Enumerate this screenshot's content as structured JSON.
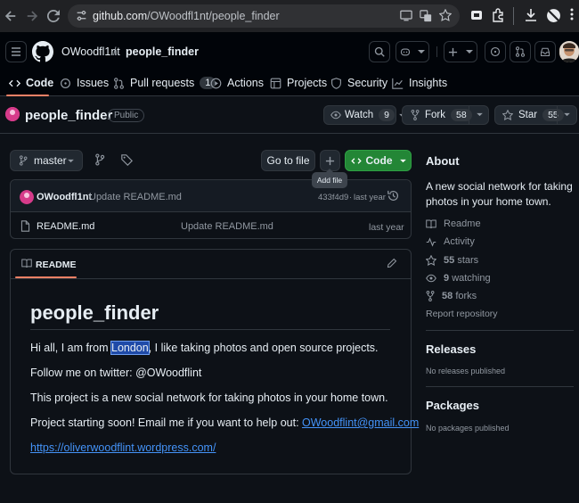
{
  "browser": {
    "url_host": "github.com",
    "url_path": "/OWoodfl1nt/people_finder"
  },
  "header": {
    "owner": "OWoodfl1nt",
    "separator": "/",
    "repo": "people_finder",
    "tabs": [
      {
        "label": "Code",
        "icon": "code-icon"
      },
      {
        "label": "Issues",
        "icon": "issue-icon"
      },
      {
        "label": "Pull requests",
        "icon": "pull-request-icon",
        "count": "1"
      },
      {
        "label": "Actions",
        "icon": "play-icon"
      },
      {
        "label": "Projects",
        "icon": "table-icon"
      },
      {
        "label": "Security",
        "icon": "shield-icon"
      },
      {
        "label": "Insights",
        "icon": "graph-icon"
      }
    ]
  },
  "repo": {
    "name": "people_finder",
    "visibility": "Public",
    "watch_label": "Watch",
    "watch_count": "9",
    "fork_label": "Fork",
    "fork_count": "58",
    "star_label": "Star",
    "star_count": "55"
  },
  "toolbar": {
    "branch": "master",
    "goto_file": "Go to file",
    "add_file_tooltip": "Add file",
    "code_button": "Code"
  },
  "commit": {
    "author": "OWoodfl1nt",
    "message": "Update README.md",
    "hash": "433f4d9",
    "dot": "·",
    "time": "last year"
  },
  "files": [
    {
      "name": "README.md",
      "message": "Update README.md",
      "time": "last year"
    }
  ],
  "readme": {
    "tab_label": "README",
    "title": "people_finder",
    "line1_before": "Hi all, I am from ",
    "line1_highlight": "London",
    "line1_after": ", I like taking photos and open source projects.",
    "line2": "Follow me on twitter: @OWoodflint",
    "line3": "This project is a new social network for taking photos in your home town.",
    "line4_text": "Project starting soon! Email me if you want to help out: ",
    "line4_email": "OWoodflint@gmail.com",
    "link": "https://oliverwoodflint.wordpress.com/"
  },
  "about": {
    "heading": "About",
    "description_line1": "A new social network for taking",
    "description_line2": "photos in your home town.",
    "readme": "Readme",
    "activity": "Activity",
    "stars_count": "55",
    "stars_label": "stars",
    "watching_count": "9",
    "watching_label": "watching",
    "forks_count": "58",
    "forks_label": "forks",
    "report": "Report repository",
    "releases_heading": "Releases",
    "releases_text": "No releases published",
    "packages_heading": "Packages",
    "packages_text": "No packages published"
  },
  "colors": {
    "accent_green": "#238636",
    "link_blue": "#4493f8",
    "tab_underline": "#f78166"
  }
}
